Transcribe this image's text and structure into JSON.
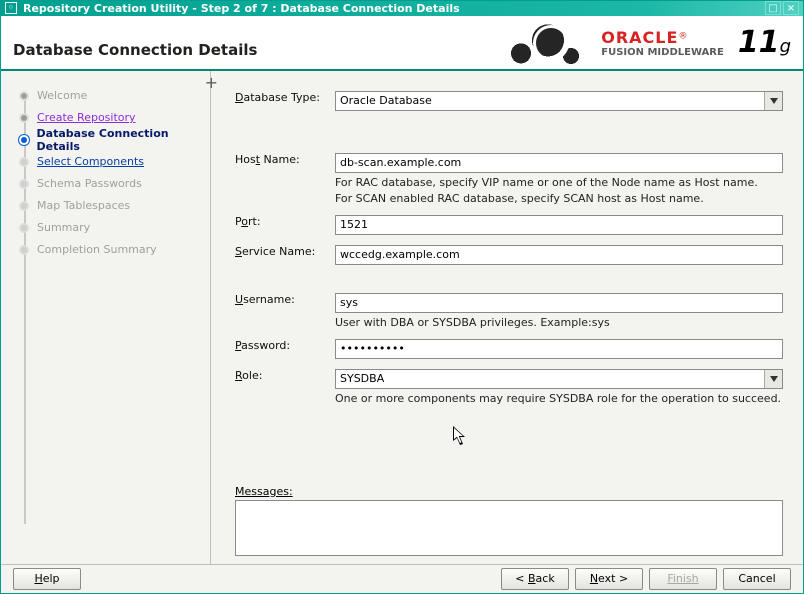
{
  "titlebar": {
    "title": "Repository Creation Utility - Step 2 of 7 : Database Connection Details"
  },
  "header": {
    "page_title": "Database Connection Details",
    "brand_top": "ORACLE",
    "brand_sub": "FUSION MIDDLEWARE",
    "brand_ver_big": "11",
    "brand_ver_small": "g"
  },
  "steps": [
    {
      "label": "Welcome"
    },
    {
      "label": "Create Repository"
    },
    {
      "label": "Database Connection Details"
    },
    {
      "label": "Select Components"
    },
    {
      "label": "Schema Passwords"
    },
    {
      "label": "Map Tablespaces"
    },
    {
      "label": "Summary"
    },
    {
      "label": "Completion Summary"
    }
  ],
  "form": {
    "db_type_label": "Database Type:",
    "db_type_value": "Oracle Database",
    "host_label": "Host Name:",
    "host_value": "db-scan.example.com",
    "host_hint1": "For RAC database, specify VIP name or one of the Node name as Host name.",
    "host_hint2": "For SCAN enabled RAC database, specify SCAN host as Host name.",
    "port_label": "Port:",
    "port_value": "1521",
    "service_label": "Service Name:",
    "service_value": "wccedg.example.com",
    "user_label": "Username:",
    "user_value": "sys",
    "user_hint": "User with DBA or SYSDBA privileges. Example:sys",
    "pwd_label": "Password:",
    "pwd_value": "••••••••••",
    "role_label": "Role:",
    "role_value": "SYSDBA",
    "role_hint": "One or more components may require SYSDBA role for the operation to succeed.",
    "messages_label": "Messages:"
  },
  "footer": {
    "help": "Help",
    "back": "< Back",
    "next": "Next >",
    "finish": "Finish",
    "cancel": "Cancel"
  }
}
